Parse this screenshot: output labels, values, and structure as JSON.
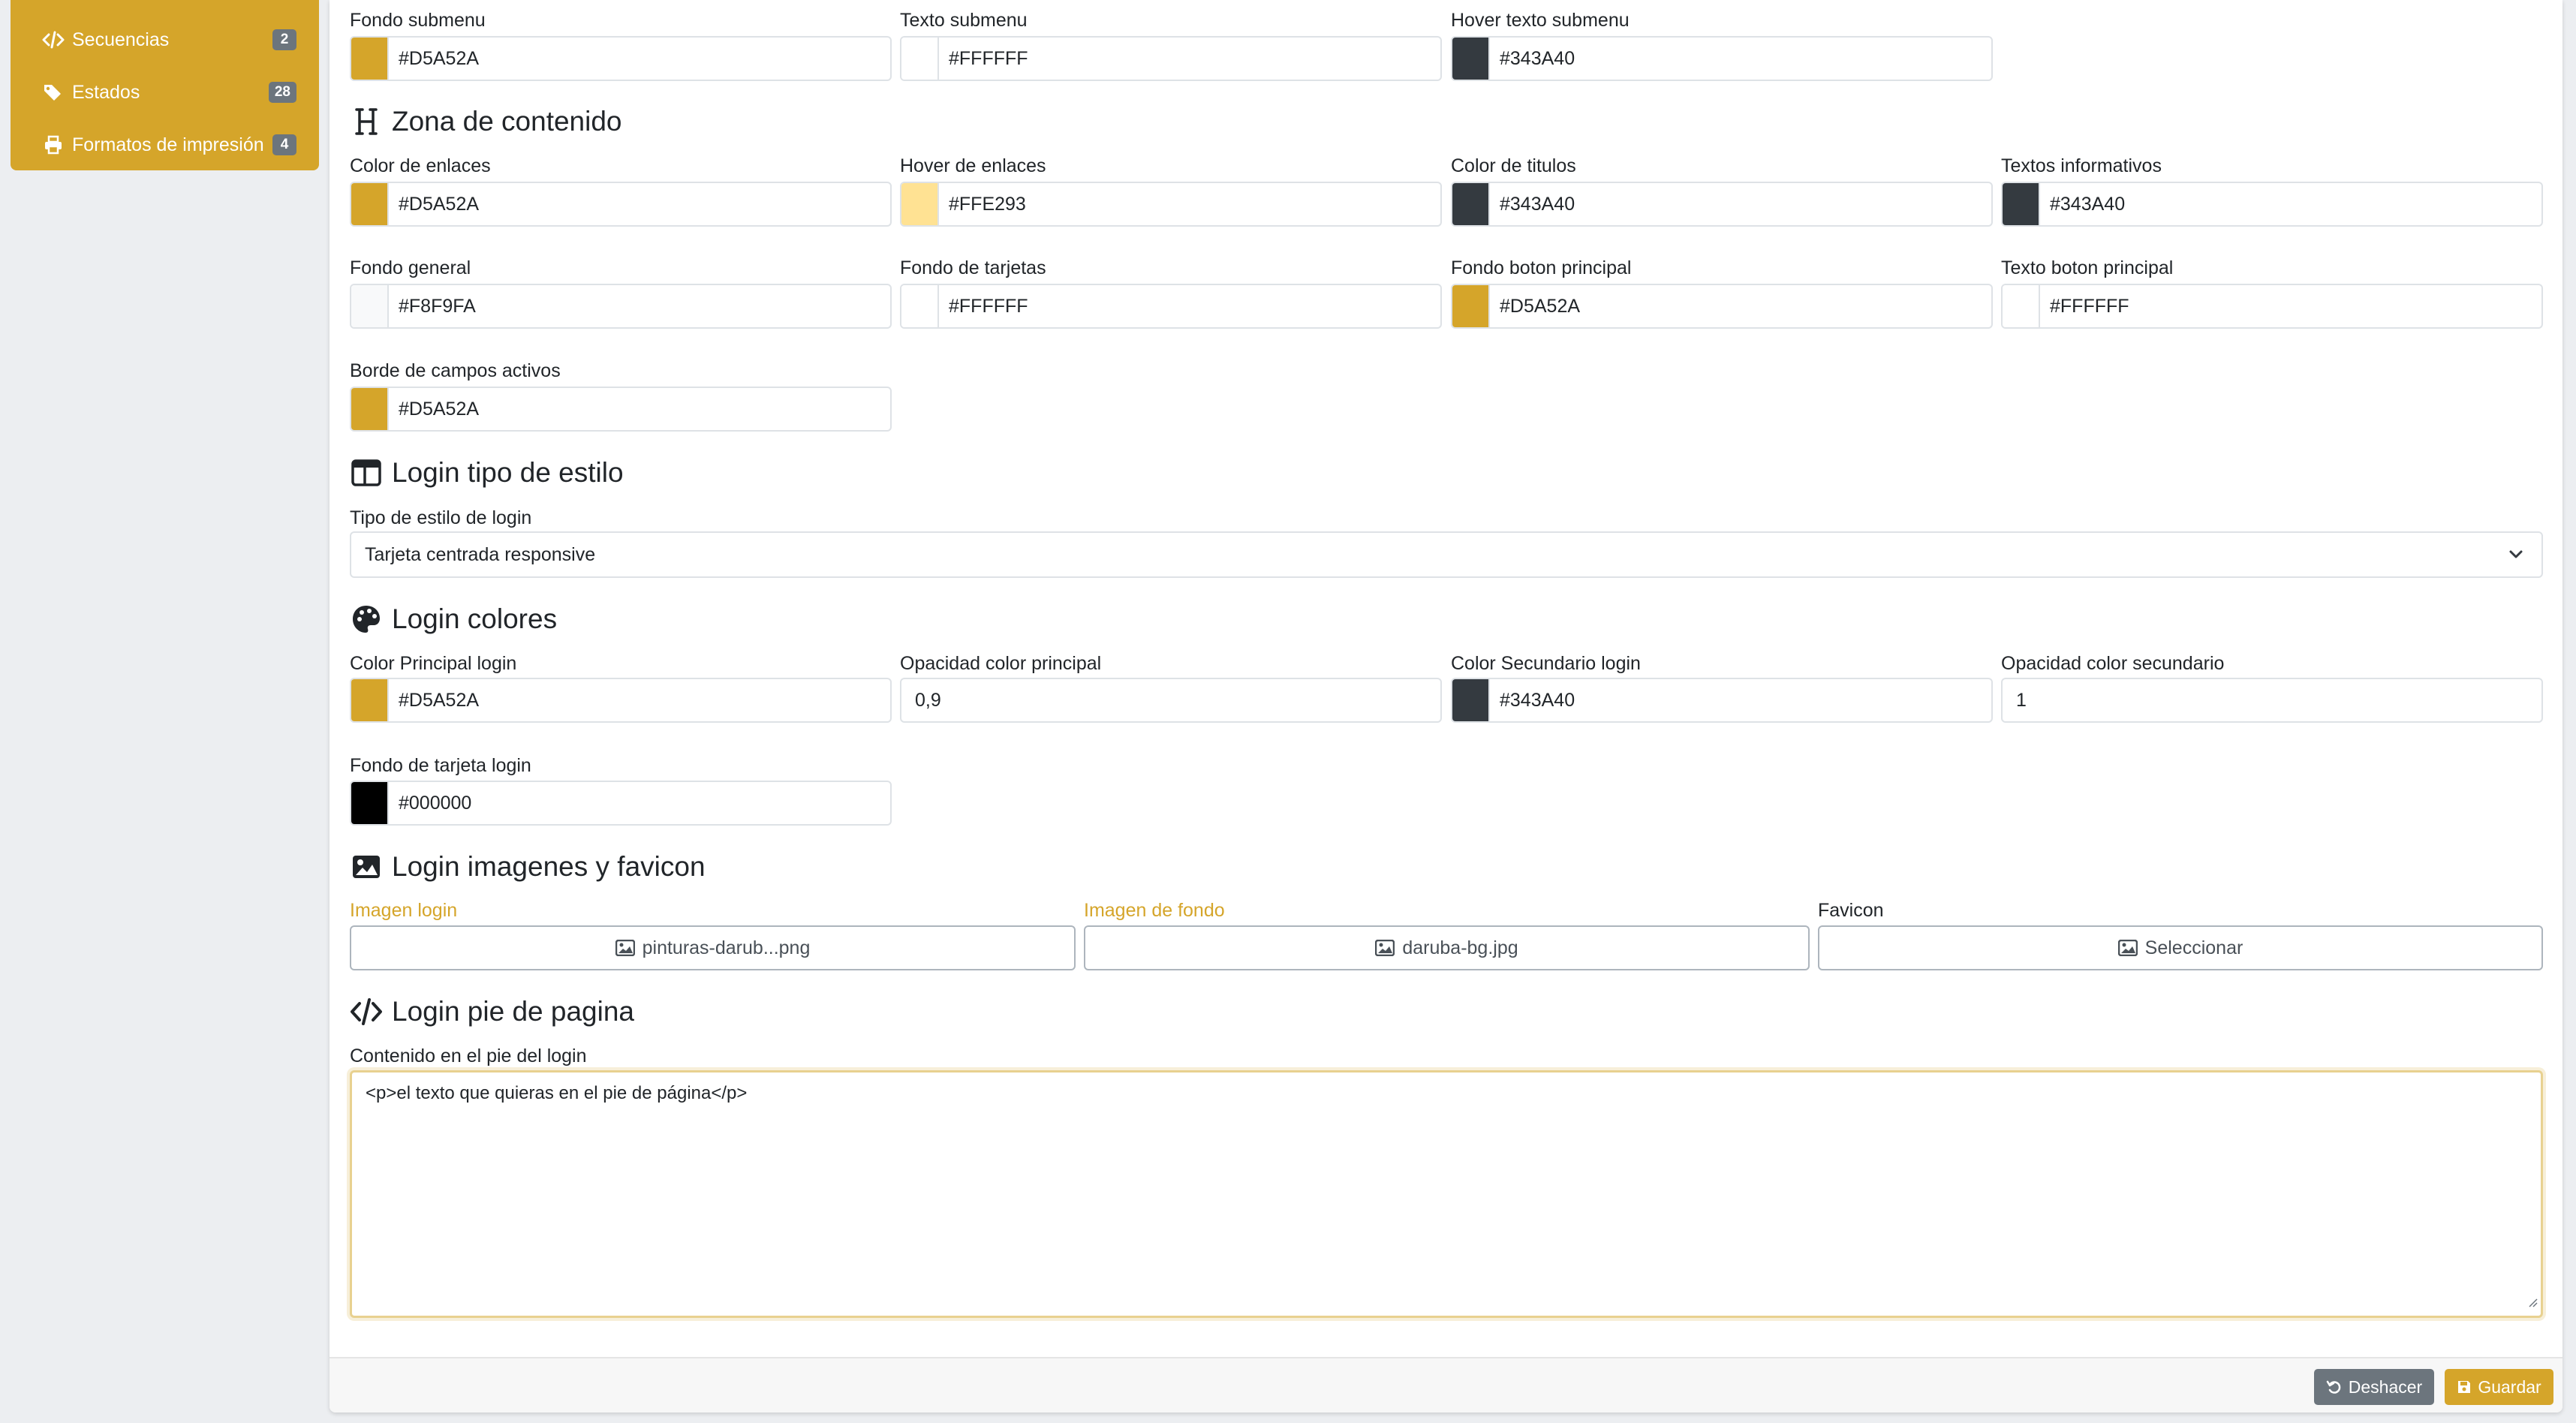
{
  "sidebar": {
    "items": [
      {
        "label": "Secuencias",
        "badge": "2"
      },
      {
        "label": "Estados",
        "badge": "28"
      },
      {
        "label": "Formatos de impresión",
        "badge": "4"
      }
    ]
  },
  "submenu": {
    "fields": [
      {
        "label": "Fondo submenu",
        "value": "#D5A52A",
        "color": "#D5A52A"
      },
      {
        "label": "Texto submenu",
        "value": "#FFFFFF",
        "color": "#FFFFFF"
      },
      {
        "label": "Hover texto submenu",
        "value": "#343A40",
        "color": "#343A40"
      }
    ]
  },
  "content_zone": {
    "title": "Zona de contenido",
    "fields": [
      {
        "label": "Color de enlaces",
        "value": "#D5A52A",
        "color": "#D5A52A"
      },
      {
        "label": "Hover de enlaces",
        "value": "#FFE293",
        "color": "#FFE293"
      },
      {
        "label": "Color de titulos",
        "value": "#343A40",
        "color": "#343A40"
      },
      {
        "label": "Textos informativos",
        "value": "#343A40",
        "color": "#343A40"
      },
      {
        "label": "Fondo general",
        "value": "#F8F9FA",
        "color": "#F8F9FA"
      },
      {
        "label": "Fondo de tarjetas",
        "value": "#FFFFFF",
        "color": "#FFFFFF"
      },
      {
        "label": "Fondo boton principal",
        "value": "#D5A52A",
        "color": "#D5A52A"
      },
      {
        "label": "Texto boton principal",
        "value": "#FFFFFF",
        "color": "#FFFFFF"
      },
      {
        "label": "Borde de campos activos",
        "value": "#D5A52A",
        "color": "#D5A52A"
      }
    ]
  },
  "login_style": {
    "title": "Login tipo de estilo",
    "select_label": "Tipo de estilo de login",
    "select_value": "Tarjeta centrada responsive"
  },
  "login_colors": {
    "title": "Login colores",
    "fields": [
      {
        "label": "Color Principal login",
        "value": "#D5A52A",
        "color": "#D5A52A"
      },
      {
        "label": "Opacidad color principal",
        "value": "0,9"
      },
      {
        "label": "Color Secundario login",
        "value": "#343A40",
        "color": "#343A40"
      },
      {
        "label": "Opacidad color secundario",
        "value": "1"
      },
      {
        "label": "Fondo de tarjeta login",
        "value": "#000000",
        "color": "#000000"
      }
    ]
  },
  "login_images": {
    "title": "Login imagenes y favicon",
    "fields": [
      {
        "label": "Imagen login",
        "value": "pinturas-darub...png"
      },
      {
        "label": "Imagen de fondo",
        "value": "daruba-bg.jpg"
      },
      {
        "label": "Favicon",
        "value": "Seleccionar"
      }
    ]
  },
  "login_footer": {
    "title": "Login pie de pagina",
    "label": "Contenido en el pie del login",
    "value": "<p>el texto que quieras en el pie de página</p>"
  },
  "actions": {
    "undo_label": "Deshacer",
    "save_label": "Guardar"
  },
  "colors": {
    "accent": "#D5A52A",
    "secondary": "#6C757D"
  }
}
